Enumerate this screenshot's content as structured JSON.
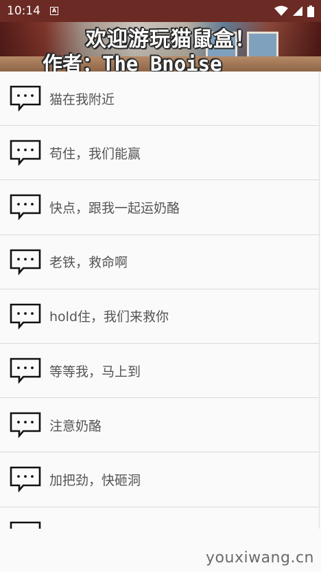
{
  "status_bar": {
    "time": "10:14",
    "notification_badge": "A",
    "icons": [
      "wifi-icon",
      "cellular-signal-icon",
      "battery-icon"
    ]
  },
  "banner": {
    "line1": "欢迎游玩猫鼠盒！",
    "line2": "作者：The_Bnoise"
  },
  "list": {
    "items": [
      {
        "label": "猫在我附近",
        "icon": "message-bubble-icon"
      },
      {
        "label": "苟住，我们能赢",
        "icon": "message-bubble-icon"
      },
      {
        "label": "快点，跟我一起运奶酪",
        "icon": "message-bubble-icon"
      },
      {
        "label": "老铁，救命啊",
        "icon": "message-bubble-icon"
      },
      {
        "label": "hold住，我们来救你",
        "icon": "message-bubble-icon"
      },
      {
        "label": "等等我，马上到",
        "icon": "message-bubble-icon"
      },
      {
        "label": "注意奶酪",
        "icon": "message-bubble-icon"
      },
      {
        "label": "加把劲，快砸洞",
        "icon": "message-bubble-icon"
      },
      {
        "label": "",
        "icon": "message-bubble-icon"
      }
    ]
  },
  "watermark": "youxiwang.cn"
}
